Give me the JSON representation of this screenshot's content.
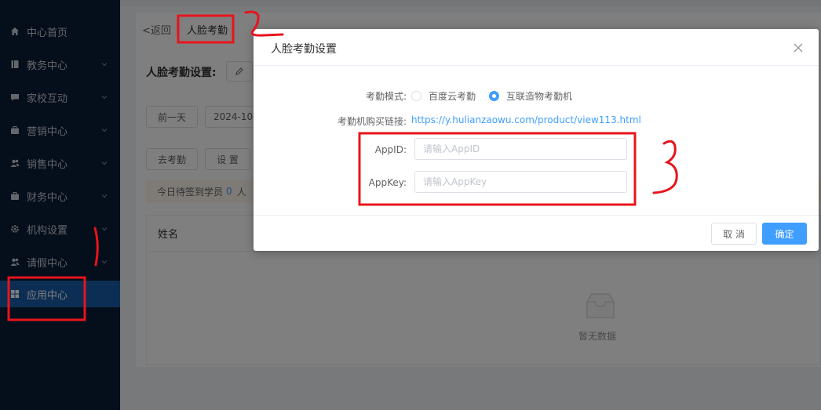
{
  "sidebar": {
    "items": [
      {
        "label": "中心首页",
        "icon": "home-icon",
        "has_arrow": false
      },
      {
        "label": "教务中心",
        "icon": "book-icon",
        "has_arrow": true
      },
      {
        "label": "家校互动",
        "icon": "chat-icon",
        "has_arrow": true
      },
      {
        "label": "营销中心",
        "icon": "briefcase-icon",
        "has_arrow": true
      },
      {
        "label": "销售中心",
        "icon": "users-icon",
        "has_arrow": true
      },
      {
        "label": "财务中心",
        "icon": "wallet-icon",
        "has_arrow": true
      },
      {
        "label": "机构设置",
        "icon": "gear-icon",
        "has_arrow": true
      },
      {
        "label": "请假中心",
        "icon": "users-icon",
        "has_arrow": true
      },
      {
        "label": "应用中心",
        "icon": "grid-icon",
        "has_arrow": false,
        "active": true
      }
    ]
  },
  "page": {
    "back_label": "返回",
    "breadcrumb_title": "人脸考勤",
    "section_title": "人脸考勤设置:",
    "prev_day": "前一天",
    "date_value": "2024-10-",
    "go_checkin": "去考勤",
    "settings": "设 置",
    "notice_prefix": "今日待签到学员",
    "notice_count": "0",
    "notice_suffix": "人",
    "table_col_name": "姓名",
    "empty_text": "暂无数据"
  },
  "dialog": {
    "title": "人脸考勤设置",
    "mode_label": "考勤模式:",
    "mode_options": [
      "百度云考勤",
      "互联造物考勤机"
    ],
    "mode_selected": "互联造物考勤机",
    "buy_link_label": "考勤机购买链接:",
    "buy_link_url": "https://y.hulianzaowu.com/product/view113.html",
    "appid_label": "AppID:",
    "appid_value": "",
    "appid_placeholder": "请输入AppID",
    "appkey_label": "AppKey:",
    "appkey_value": "",
    "appkey_placeholder": "请输入AppKey",
    "cancel_label": "取 消",
    "confirm_label": "确定"
  },
  "colors": {
    "sidebar_bg": "#0b1d36",
    "sidebar_active": "#1a5ca8",
    "primary": "#409eff",
    "annotation_red": "#e8141c"
  }
}
